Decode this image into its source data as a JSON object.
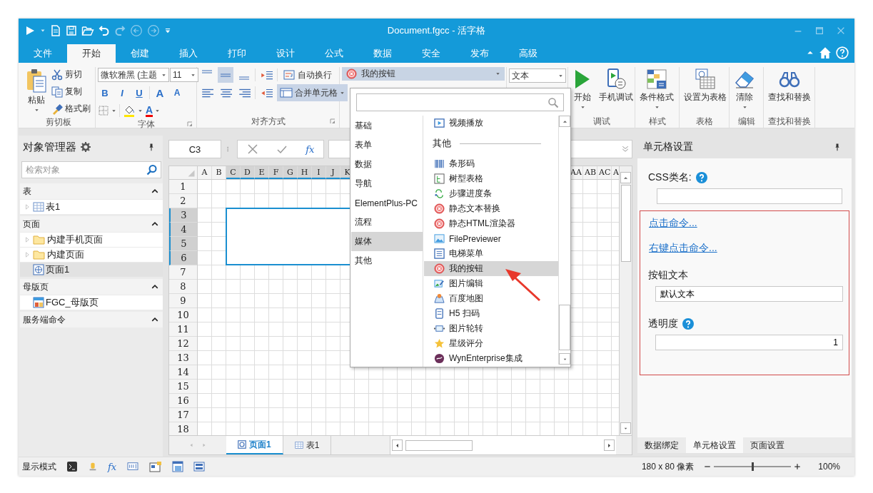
{
  "window": {
    "title": "Document.fgcc - 活字格"
  },
  "ribbon_tabs": [
    {
      "label": "文件",
      "selected": false
    },
    {
      "label": "开始",
      "selected": true
    },
    {
      "label": "创建",
      "selected": false
    },
    {
      "label": "插入",
      "selected": false
    },
    {
      "label": "打印",
      "selected": false
    },
    {
      "label": "设计",
      "selected": false
    },
    {
      "label": "公式",
      "selected": false
    },
    {
      "label": "数据",
      "selected": false
    },
    {
      "label": "安全",
      "selected": false
    },
    {
      "label": "发布",
      "selected": false
    },
    {
      "label": "高级",
      "selected": false
    }
  ],
  "ribbon": {
    "clipboard": {
      "paste": "粘贴",
      "cut": "剪切",
      "copy": "复制",
      "format_painter": "格式刷",
      "group": "剪切板"
    },
    "font": {
      "family": "微软雅黑 (主题",
      "size": "11",
      "bold": "B",
      "italic": "I",
      "underline": "U",
      "grow": "A",
      "shrink": "A",
      "foreground_button": "A",
      "group": "字体"
    },
    "alignment": {
      "vertical": [
        {
          "kind": "top",
          "selected": false
        },
        {
          "kind": "middle",
          "selected": true
        },
        {
          "kind": "bottom",
          "selected": false
        }
      ],
      "wrap": {
        "label": "自动换行",
        "on": false
      },
      "merge": {
        "label": "合并单元格",
        "on": true
      },
      "group": "对齐方式"
    },
    "cell_type": {
      "value": "我的按钮"
    },
    "text_type": {
      "value": "文本"
    },
    "debug": {
      "run": "开始",
      "mobile": "手机调试",
      "group": "调试"
    },
    "style": {
      "label": "条件格式",
      "group": "样式"
    },
    "table": {
      "label": "设置为表格",
      "group": "表格"
    },
    "edit": {
      "label": "清除",
      "group": "编辑"
    },
    "find": {
      "label": "查找和替换",
      "group": "查找和替换"
    }
  },
  "object_manager": {
    "title": "对象管理器",
    "search": {
      "placeholder": "检索对象"
    },
    "sections": [
      {
        "title": "表",
        "expanded": true,
        "items": [
          {
            "label": "表1",
            "kind": "table",
            "expandable": true,
            "selected": false
          }
        ]
      },
      {
        "title": "页面",
        "expanded": true,
        "items": [
          {
            "label": "内建手机页面",
            "kind": "folder",
            "expandable": true,
            "selected": false
          },
          {
            "label": "内建页面",
            "kind": "folder",
            "expandable": true,
            "selected": false
          },
          {
            "label": "页面1",
            "kind": "page",
            "expandable": false,
            "selected": true
          }
        ]
      },
      {
        "title": "母版页",
        "expanded": true,
        "items": [
          {
            "label": "FGC_母版页",
            "kind": "master",
            "expandable": false,
            "selected": false
          }
        ]
      },
      {
        "title": "服务端命令",
        "expanded": true
      }
    ]
  },
  "formula_bar": {
    "cell": "C3",
    "fx": "fx"
  },
  "sheet": {
    "columns_left": [
      {
        "label": "A",
        "selected": false
      },
      {
        "label": "B",
        "selected": false
      },
      {
        "label": "C",
        "selected": true
      },
      {
        "label": "D",
        "selected": true
      },
      {
        "label": "E",
        "selected": true
      },
      {
        "label": "F",
        "selected": true
      },
      {
        "label": "G",
        "selected": true
      },
      {
        "label": "H",
        "selected": true
      },
      {
        "label": "I",
        "selected": true
      },
      {
        "label": "J",
        "selected": true
      },
      {
        "label": "K",
        "selected": true
      }
    ],
    "columns_right": [
      {
        "label": "AA",
        "selected": false
      },
      {
        "label": "AB",
        "selected": false
      },
      {
        "label": "AC",
        "selected": false
      },
      {
        "label": "A",
        "selected": false
      }
    ],
    "rows": [
      {
        "label": "1",
        "selected": false
      },
      {
        "label": "2",
        "selected": false
      },
      {
        "label": "3",
        "selected": true
      },
      {
        "label": "4",
        "selected": true
      },
      {
        "label": "5",
        "selected": true
      },
      {
        "label": "6",
        "selected": true
      },
      {
        "label": "7",
        "selected": false
      },
      {
        "label": "8",
        "selected": false
      },
      {
        "label": "9",
        "selected": false
      },
      {
        "label": "10",
        "selected": false
      },
      {
        "label": "11",
        "selected": false
      },
      {
        "label": "12",
        "selected": false
      },
      {
        "label": "13",
        "selected": false
      },
      {
        "label": "14",
        "selected": false
      },
      {
        "label": "15",
        "selected": false
      },
      {
        "label": "16",
        "selected": false
      },
      {
        "label": "17",
        "selected": false
      },
      {
        "label": "18",
        "selected": false
      }
    ],
    "tabs": [
      {
        "label": "页面1",
        "kind": "page",
        "selected": true
      },
      {
        "label": "表1",
        "kind": "table",
        "selected": false
      }
    ]
  },
  "cell_type_popup": {
    "categories": [
      {
        "label": "基础",
        "selected": false
      },
      {
        "label": "表单",
        "selected": false
      },
      {
        "label": "数据",
        "selected": false
      },
      {
        "label": "导航",
        "selected": false
      },
      {
        "label": "ElementPlus-PC",
        "selected": false
      },
      {
        "label": "流程",
        "selected": false
      },
      {
        "label": "媒体",
        "selected": true
      },
      {
        "label": "其他",
        "selected": false
      }
    ],
    "items": [
      {
        "label": "视频播放",
        "kind": "video",
        "selected": false
      },
      {
        "label": "其他",
        "kind": "heading"
      },
      {
        "label": "条形码",
        "kind": "barcode",
        "selected": false
      },
      {
        "label": "树型表格",
        "kind": "tree",
        "selected": false
      },
      {
        "label": "步骤进度条",
        "kind": "steps",
        "selected": false
      },
      {
        "label": "静态文本替换",
        "kind": "custom",
        "selected": false
      },
      {
        "label": "静态HTML渲染器",
        "kind": "custom",
        "selected": false
      },
      {
        "label": "FilePreviewer",
        "kind": "image",
        "selected": false
      },
      {
        "label": "电梯菜单",
        "kind": "menu",
        "selected": false
      },
      {
        "label": "我的按钮",
        "kind": "custom",
        "selected": true
      },
      {
        "label": "图片编辑",
        "kind": "image_edit",
        "selected": false
      },
      {
        "label": "百度地图",
        "kind": "map",
        "selected": false
      },
      {
        "label": "H5 扫码",
        "kind": "scan",
        "selected": false
      },
      {
        "label": "图片轮转",
        "kind": "carousel",
        "selected": false
      },
      {
        "label": "星级评分",
        "kind": "star",
        "selected": false
      },
      {
        "label": "WynEnterprise集成",
        "kind": "wyn",
        "selected": false
      }
    ]
  },
  "cell_settings": {
    "title": "单元格设置",
    "css_label": "CSS类名:",
    "click_command": "点击命令...",
    "right_click_command": "右键点击命令...",
    "button_text_label": "按钮文本",
    "button_text": "默认文本",
    "opacity_label": "透明度",
    "opacity": "1",
    "tabs": [
      {
        "label": "数据绑定",
        "selected": false
      },
      {
        "label": "单元格设置",
        "selected": true
      },
      {
        "label": "页面设置",
        "selected": false
      }
    ]
  },
  "status_bar": {
    "mode": "显示模式",
    "fx": "fx",
    "size": "180 x 80 像素",
    "zoom": {
      "level": 0.5
    },
    "zoom_text": "100%"
  }
}
